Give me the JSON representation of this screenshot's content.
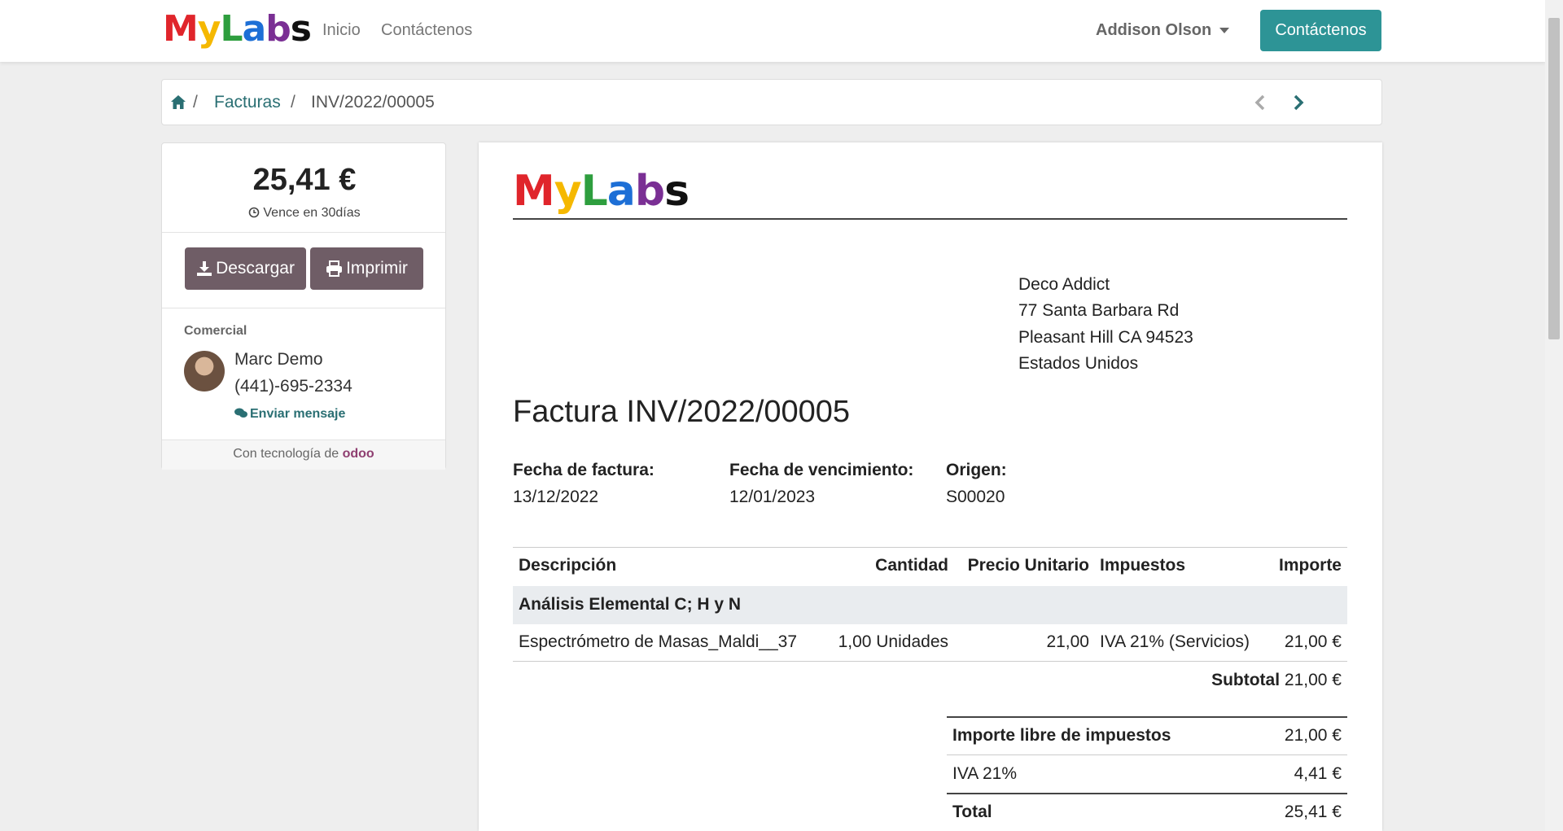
{
  "brand": {
    "logo_letters": [
      "M",
      "y",
      "L",
      "a",
      "b",
      "s"
    ],
    "logo_colors": [
      "#e0252b",
      "#f5b800",
      "#2e9e3e",
      "#1d6fd6",
      "#7a2f94",
      "#111111"
    ]
  },
  "navbar": {
    "links": [
      "Inicio",
      "Contáctenos"
    ],
    "user": "Addison Olson",
    "cta_label": "Contáctenos",
    "accent": "#2d9496"
  },
  "breadcrumb": {
    "section": "Facturas",
    "current": "INV/2022/00005",
    "separator": "/"
  },
  "sidebar": {
    "amount": "25,41 €",
    "due": "Vence en 30días",
    "download_label": "Descargar",
    "print_label": "Imprimir",
    "button_color": "#6f5d66",
    "salesperson_label": "Comercial",
    "salesperson_name": "Marc Demo",
    "salesperson_phone": "(441)-695-2334",
    "send_message_label": "Enviar mensaje",
    "powered_by": "Con tecnología de",
    "powered_brand": "odoo"
  },
  "invoice": {
    "address": [
      "Deco Addict",
      "77 Santa Barbara Rd",
      "Pleasant Hill CA 94523",
      "Estados Unidos"
    ],
    "title": "Factura INV/2022/00005",
    "meta": {
      "invoice_date_label": "Fecha de factura:",
      "invoice_date": "13/12/2022",
      "due_date_label": "Fecha de vencimiento:",
      "due_date": "12/01/2023",
      "origin_label": "Origen:",
      "origin": "S00020"
    },
    "columns": {
      "description": "Descripción",
      "quantity": "Cantidad",
      "unit_price": "Precio Unitario",
      "taxes": "Impuestos",
      "amount": "Importe"
    },
    "section_name": "Análisis Elemental C; H y N",
    "line": {
      "description": "Espectrómetro de Masas_Maldi__37",
      "quantity": "1,00 Unidades",
      "unit_price": "21,00",
      "taxes": "IVA 21% (Servicios)",
      "amount": "21,00 €"
    },
    "subtotal_label": "Subtotal",
    "subtotal_value": "21,00 €",
    "totals": {
      "untaxed_label": "Importe libre de impuestos",
      "untaxed_value": "21,00 €",
      "tax_label": "IVA 21%",
      "tax_value": "4,41 €",
      "total_label": "Total",
      "total_value": "25,41 €"
    }
  }
}
